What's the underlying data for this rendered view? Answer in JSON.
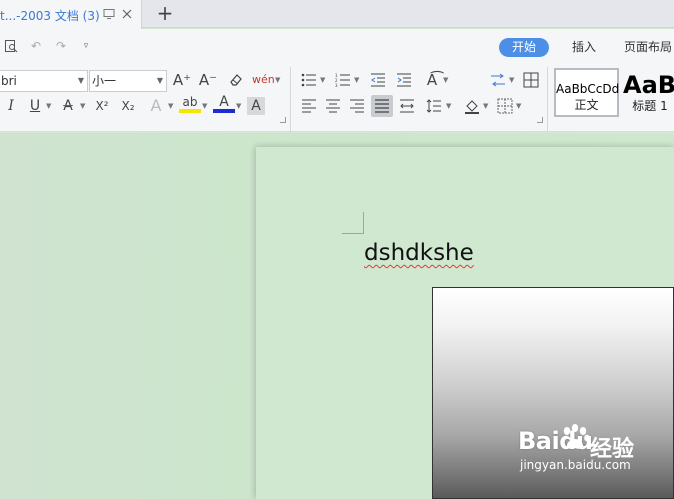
{
  "tab": {
    "title": "t...-2003 文档 (3)",
    "new_tab_label": "+"
  },
  "ribbon": {
    "tabs": [
      {
        "label": "开始",
        "active": true
      },
      {
        "label": "插入",
        "active": false
      },
      {
        "label": "页面布局",
        "active": false
      }
    ]
  },
  "font": {
    "name": "bri",
    "size": "小一"
  },
  "toolbar_glyphs": {
    "grow_font": "A⁺",
    "shrink_font": "A⁻",
    "phonetic": "wén",
    "italic": "I",
    "underline": "U",
    "strikethrough": "A",
    "superscript": "X²",
    "subscript": "X₂",
    "text_effect": "A",
    "highlight": "ab",
    "font_color": "A",
    "char_shading": "A"
  },
  "styles": [
    {
      "sample": "AaBbCcDd",
      "name": "正文"
    },
    {
      "sample": "AaBl",
      "name": "标题 1"
    }
  ],
  "document": {
    "text": "dshdkshe"
  },
  "watermark": {
    "logo": "Baidu",
    "cn": "经验",
    "url": "jingyan.baidu.com"
  },
  "colors": {
    "accent": "#4d8fe6",
    "tab_title": "#3b78d4",
    "workspace_bg": "#d2e8d1",
    "spellcheck": "#e23b3b",
    "highlight": "#f5e600",
    "font_color_bar": "#1b2bd8"
  },
  "icons": {
    "tab_view": "monitor-icon",
    "tab_close": "close-icon",
    "print_preview": "print-preview-icon",
    "undo": "undo-icon",
    "redo": "redo-icon",
    "customize": "chevron-down-icon"
  }
}
